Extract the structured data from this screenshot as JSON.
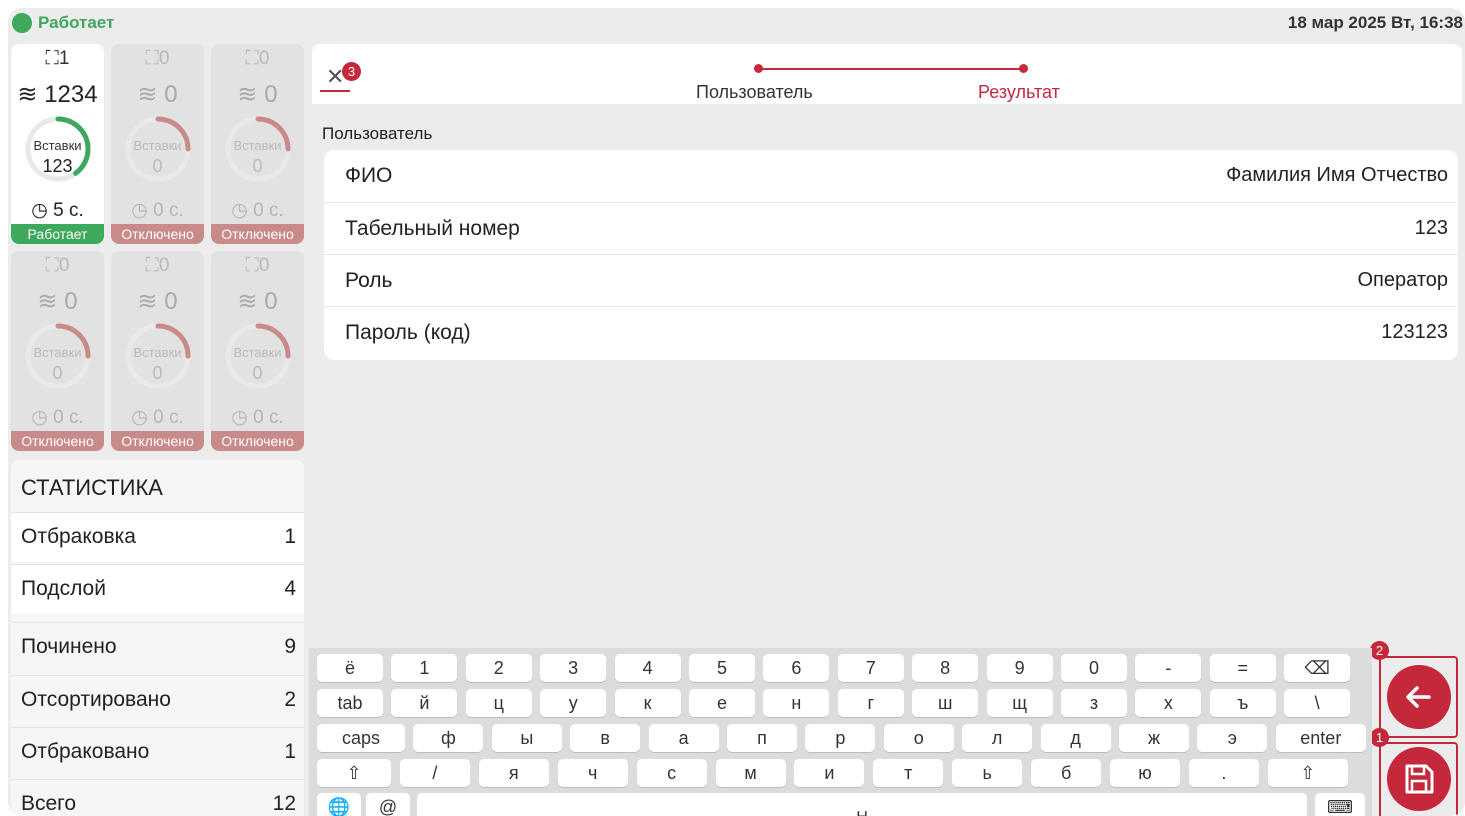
{
  "status": {
    "text": "Работает",
    "datetime": "18 мар 2025 Вт, 16:38",
    "color": "#3ea85c"
  },
  "machines": [
    {
      "top": "1",
      "count": "1234",
      "ring_label": "Вставки",
      "ring_value": "123",
      "time": "5 с.",
      "state": "Работает",
      "active": true,
      "ring_progress": 0.4
    },
    {
      "top": "0",
      "count": "0",
      "ring_label": "Вставки",
      "ring_value": "0",
      "time": "0 с.",
      "state": "Отключено",
      "active": false,
      "ring_progress": 0.25
    },
    {
      "top": "0",
      "count": "0",
      "ring_label": "Вставки",
      "ring_value": "0",
      "time": "0 с.",
      "state": "Отключено",
      "active": false,
      "ring_progress": 0.25
    },
    {
      "top": "0",
      "count": "0",
      "ring_label": "Вставки",
      "ring_value": "0",
      "time": "0 с.",
      "state": "Отключено",
      "active": false,
      "ring_progress": 0.25
    },
    {
      "top": "0",
      "count": "0",
      "ring_label": "Вставки",
      "ring_value": "0",
      "time": "0 с.",
      "state": "Отключено",
      "active": false,
      "ring_progress": 0.25
    },
    {
      "top": "0",
      "count": "0",
      "ring_label": "Вставки",
      "ring_value": "0",
      "time": "0 с.",
      "state": "Отключено",
      "active": false,
      "ring_progress": 0.25
    }
  ],
  "stats": {
    "title": "СТАТИСТИКА",
    "rows": [
      {
        "label": "Отбраковка",
        "value": "1"
      },
      {
        "label": "Подслой",
        "value": "4"
      },
      {
        "label": "Починено",
        "value": "9"
      },
      {
        "label": "Отсортировано",
        "value": "2"
      },
      {
        "label": "Отбраковано",
        "value": "1"
      },
      {
        "label": "Всего",
        "value": "12"
      }
    ]
  },
  "wizard": {
    "close_badge": "3",
    "steps": [
      {
        "label": "Пользователь"
      },
      {
        "label": "Результат"
      }
    ],
    "section_title": "Пользователь",
    "fields": [
      {
        "label": "ФИО",
        "value": "Фамилия Имя Отчество"
      },
      {
        "label": "Табельный номер",
        "value": "123"
      },
      {
        "label": "Роль",
        "value": "Оператор"
      },
      {
        "label": "Пароль (код)",
        "value": "123123"
      }
    ]
  },
  "keyboard": {
    "rows": [
      [
        "ё",
        "1",
        "2",
        "3",
        "4",
        "5",
        "6",
        "7",
        "8",
        "9",
        "0",
        "-",
        "=",
        "⌫"
      ],
      [
        "tab",
        "й",
        "ц",
        "у",
        "к",
        "е",
        "н",
        "г",
        "ш",
        "щ",
        "з",
        "х",
        "ъ",
        "\\"
      ],
      [
        "caps",
        "ф",
        "ы",
        "в",
        "а",
        "п",
        "р",
        "о",
        "л",
        "д",
        "ж",
        "э",
        "enter"
      ],
      [
        "⇧",
        "/",
        "я",
        "ч",
        "с",
        "м",
        "и",
        "т",
        "ь",
        "б",
        "ю",
        ".",
        "⇧"
      ],
      [
        "🌐",
        "@",
        "␣",
        "⌨"
      ]
    ]
  },
  "actions": {
    "back_badge": "2",
    "save_badge": "1",
    "accent": "#c4283a"
  }
}
